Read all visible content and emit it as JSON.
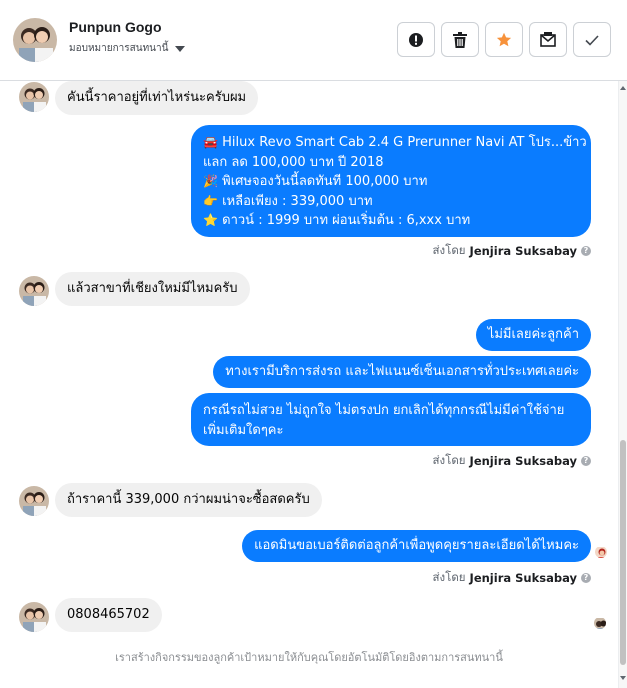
{
  "header": {
    "contact_name": "Punpun Gogo",
    "assign_label": "มอบหมายการสนทนานี้",
    "actions": [
      {
        "icon": "alert-icon"
      },
      {
        "icon": "trash-icon"
      },
      {
        "icon": "star-icon",
        "color": "#f7923b"
      },
      {
        "icon": "mark-unread-icon"
      },
      {
        "icon": "check-icon"
      }
    ]
  },
  "messages": {
    "m1": "คันนี้ราคาอยู่ที่เท่าไหร่นะครับผม",
    "m2": {
      "line1": "Hilux Revo Smart Cab 2.4 G Prerunner Navi AT โปร...ข้าว",
      "line2": "แลก ลด 100,000 บาท ปี 2018",
      "line3": "พิเศษจองวันนี้ลดทันที 100,000 บาท",
      "line4": "เหลือเพียง : 339,000 บาท",
      "line5": "ดาวน์ : 1999 บาท ผ่อนเริ่มต้น : 6,xxx บาท",
      "emoji1": "🚘",
      "emoji2": "🎉",
      "emoji3": "👉",
      "emoji4": "⭐"
    },
    "m3": "แล้วสาขาที่เชียงใหม่มีไหมครับ",
    "m4": "ไม่มีเลยค่ะลูกค้า",
    "m5": "ทางเรามีบริการส่งรถ และไฟแนนซ์เซ็นเอกสารทั่วประเทศเลยค่ะ",
    "m6": {
      "line1": "กรณีรถไม่สวย ไม่ถูกใจ ไม่ตรงปก ยกเลิกได้ทุกกรณีไม่มีค่าใช้จ่าย",
      "line2": "เพิ่มเติมใดๆคะ"
    },
    "m7": "ถ้าราคานี้ 339,000 กว่าผมน่าจะซื้อสดครับ",
    "m8": "แอดมินขอเบอร์ติดต่อลูกค้าเพื่อพูดคุยรายละเอียดได้ไหมคะ",
    "m9": "0808465702"
  },
  "sent_by": {
    "prefix": "ส่งโดย",
    "agent": "Jenjira Suksabay",
    "help": "?"
  },
  "footer_note": "เราสร้างกิจกรรมของลูกค้าเป้าหมายให้กับคุณโดยอัตโนมัติโดยอิงตามการสนทนานี้",
  "colors": {
    "outgoing_bubble": "#0a7cff",
    "incoming_bubble": "#f0f0f0",
    "star": "#f7923b"
  }
}
